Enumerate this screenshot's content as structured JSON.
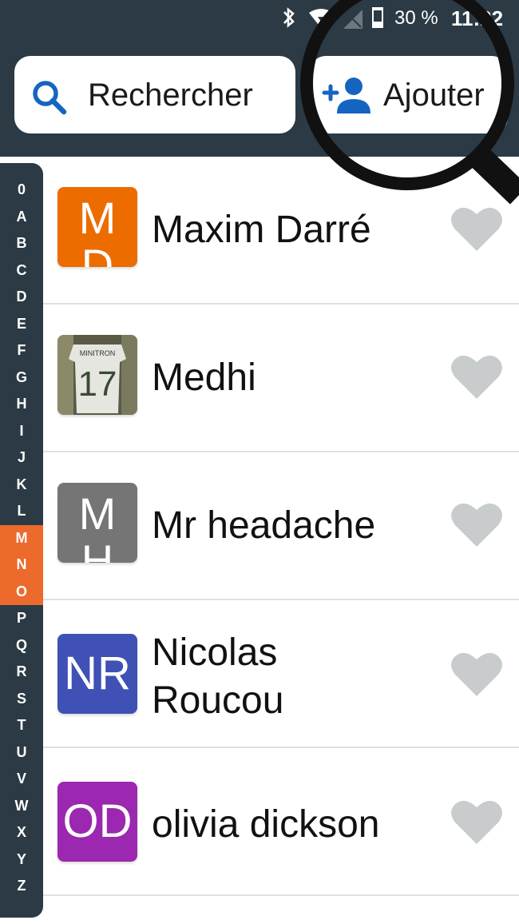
{
  "status_bar": {
    "bluetooth_icon": "bluetooth-icon",
    "wifi_icon": "wifi-icon",
    "signal_icon": "signal-icon",
    "battery_level": 0.3,
    "battery_text": "30 %",
    "time": "11:22"
  },
  "header": {
    "search_label": "Rechercher",
    "add_label": "Ajouter"
  },
  "colors": {
    "header_bg": "#2b3a44",
    "search_icon": "#1565c0",
    "add_icon": "#1565c0",
    "index_active": "#ec6a2c",
    "heart": "#c9cccd"
  },
  "contacts": [
    {
      "name": "Maxim Darré",
      "initials_line1": "M",
      "initials_line2": "D",
      "avatar_color": "#ec6c00",
      "favorite": false
    },
    {
      "name": "Medhi",
      "initials_line1": "",
      "initials_line2": "",
      "avatar_color": "#6d6a55",
      "photo": true,
      "photo_text": "MINITRON",
      "photo_number": "17",
      "favorite": false
    },
    {
      "name": "Mr headache",
      "initials_line1": "M",
      "initials_line2": "H",
      "avatar_color": "#757575",
      "favorite": false
    },
    {
      "name": "Nicolas Roucou",
      "name_line1": "Nicolas",
      "name_line2": "Roucou",
      "initials_line1": "NR",
      "initials_line2": "",
      "avatar_color": "#3f51b5",
      "favorite": false
    },
    {
      "name": "olivia dickson",
      "initials_line1": "OD",
      "initials_line2": "",
      "avatar_color": "#9c27b0",
      "favorite": false
    }
  ],
  "index": {
    "letters": [
      "0",
      "A",
      "B",
      "C",
      "D",
      "E",
      "F",
      "G",
      "H",
      "I",
      "J",
      "K",
      "L",
      "M",
      "N",
      "O",
      "P",
      "Q",
      "R",
      "S",
      "T",
      "U",
      "V",
      "W",
      "X",
      "Y",
      "Z"
    ],
    "active": [
      "M",
      "N",
      "O"
    ]
  }
}
